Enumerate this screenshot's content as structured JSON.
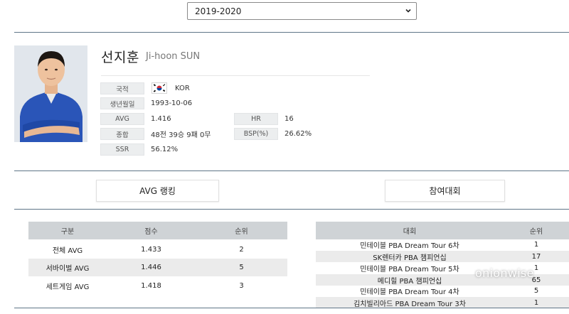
{
  "season": {
    "selected": "2019-2020"
  },
  "player": {
    "name_ko": "선지훈",
    "name_en": "Ji-hoon SUN",
    "nationality_label": "국적",
    "nationality": "KOR",
    "birth_label": "생년월일",
    "birth": "1993-10-06",
    "avg_label": "AVG",
    "avg": "1.416",
    "hr_label": "HR",
    "hr": "16",
    "record_label": "종합",
    "record": "48전 39승 9패 0무",
    "bsp_label": "BSP(%)",
    "bsp": "26.62%",
    "ssr_label": "SSR",
    "ssr": "56.12%"
  },
  "sections": {
    "avg_ranking": "AVG 랭킹",
    "tournaments": "참여대회"
  },
  "avg_table": {
    "headers": [
      "구분",
      "점수",
      "순위"
    ],
    "rows": [
      [
        "전체 AVG",
        "1.433",
        "2"
      ],
      [
        "서바이벌 AVG",
        "1.446",
        "5"
      ],
      [
        "세트게임 AVG",
        "1.418",
        "3"
      ]
    ]
  },
  "tour_table": {
    "headers": [
      "대회",
      "순위"
    ],
    "rows": [
      [
        "민테이블 PBA Dream Tour 6차",
        "1"
      ],
      [
        "SK렌터카 PBA 챔피언십",
        "17"
      ],
      [
        "민테이블 PBA Dream Tour 5차",
        "1"
      ],
      [
        "메디힐 PBA 챔피언십",
        "65"
      ],
      [
        "민테이블 PBA Dream Tour 4차",
        "5"
      ],
      [
        "김치빌리아드 PBA Dream Tour 3차",
        "1"
      ]
    ]
  },
  "watermark": "onionwise",
  "icons": {
    "select_arrow": "chevron-down-icon",
    "flag": "korea-flag-icon"
  }
}
